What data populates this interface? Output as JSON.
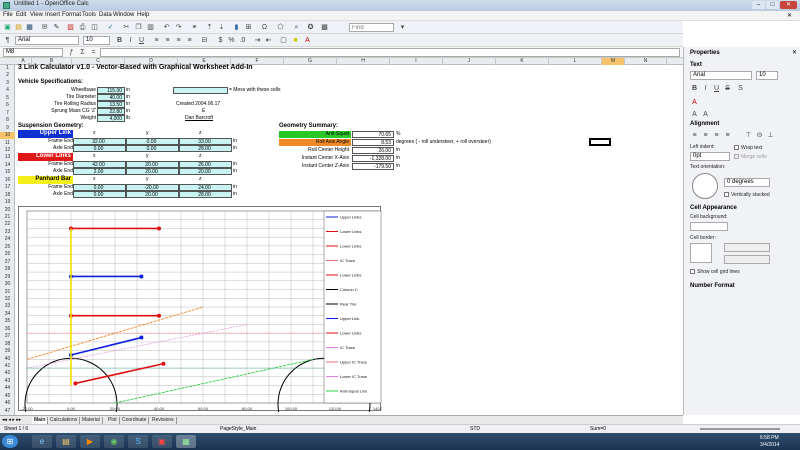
{
  "window": {
    "title": "Untitled 1 - OpenOffice Calc"
  },
  "menu": [
    "File",
    "Edit",
    "View",
    "Insert",
    "Format",
    "Tools",
    "Data",
    "Window",
    "Help"
  ],
  "toolbar": {
    "font_name": "Arial",
    "font_size": "10",
    "find_placeholder": "Find"
  },
  "formula": {
    "cell_ref": "M8"
  },
  "columns": [
    "A",
    "B",
    "C",
    "D",
    "E",
    "F",
    "G",
    "H",
    "I",
    "J",
    "K",
    "L",
    "M",
    "N"
  ],
  "rows": [
    "1",
    "2",
    "3",
    "4",
    "5",
    "6",
    "7",
    "8",
    "9",
    "10",
    "11",
    "12",
    "13",
    "14",
    "15",
    "16",
    "17",
    "18",
    "19",
    "20",
    "21",
    "22",
    "23",
    "24",
    "25",
    "26",
    "27",
    "28",
    "29",
    "30",
    "31",
    "32",
    "33",
    "34",
    "35",
    "36",
    "37",
    "38",
    "39",
    "40",
    "41",
    "42",
    "43",
    "44",
    "45",
    "46",
    "47"
  ],
  "sheet": {
    "title": "3 Link Calculator v1.0  -  Vector-Based with Graphical Worksheet Add-In",
    "vehicle_specs": "Vehicle Specifications:",
    "labels": {
      "wheelbase": "Wheelbase",
      "tire_diameter": "Tire Diameter",
      "tire_rolling_radius": "Tire Rolling Radius",
      "sprung_mass_cg": "Sprung Mass CG 'Z'",
      "weight": "Weight"
    },
    "values": {
      "wheelbase": "115.00",
      "tire_diameter": "40.00",
      "tire_rolling_radius": "13.50",
      "sprung_mass_cg": "22.80",
      "weight": "4,000"
    },
    "units": {
      "in": "in",
      "lb": "lb"
    },
    "legend_note": "= Mess with these cells",
    "created": "Created 2004.06.17",
    "author_e": "E",
    "author": "Dan Barcroft",
    "suspension": "Suspension Geometry:",
    "upper_link": "Upper Link",
    "lower_links": "Lower Links",
    "panhard": "Panhard Bar",
    "x": "x",
    "y": "y",
    "z": "z",
    "frame_end": "Frame End",
    "axle_end": "Axle End",
    "upper": {
      "frame": [
        "32.00",
        "0.00",
        "33.00"
      ],
      "axle": [
        "0.00",
        "0.00",
        "28.00"
      ]
    },
    "lower": {
      "frame": [
        "42.00",
        "20.00",
        "26.00"
      ],
      "axle": [
        "2.00",
        "20.00",
        "20.00"
      ]
    },
    "pan": {
      "frame": [
        "0.00",
        "-20.00",
        "24.00"
      ],
      "axle": [
        "0.00",
        "20.00",
        "28.00"
      ]
    },
    "geom_summary": "Geometry Summary:",
    "g_labels": [
      "Anti-Squat",
      "Roll Axis Angle",
      "Roll Center Height",
      "Instant Center X-Axis",
      "Instant Center Z-Axis"
    ],
    "g_values": [
      "70.65",
      "8.53",
      "26.00",
      "-1,328.00",
      "-179.50"
    ],
    "g_units": [
      "%",
      "degrees ( - roll understeer, + roll oversteer)",
      "in",
      "in",
      "in"
    ]
  },
  "chart_data": {
    "type": "line",
    "x_ticks": [
      "-20.00",
      "0.00",
      "20.00",
      "40.00",
      "60.00",
      "80.00",
      "100.00",
      "120.00",
      "140.00"
    ],
    "xlim": [
      -20,
      140
    ],
    "ylim": [
      -2,
      42
    ],
    "legend": [
      "Upper Links",
      "Lower Links",
      "Lower Links",
      "IC Trace",
      "Lower Links",
      "Column C",
      "Rear Tire",
      "Upper Link",
      "Lower Links",
      "IC Trace",
      "Upper IC Trace",
      "Lower IC Trace",
      "Anti-Squat Line"
    ],
    "series": [
      {
        "color": "#e01010",
        "x": [
          0,
          40
        ],
        "y": [
          38,
          38
        ]
      },
      {
        "color": "#1020e0",
        "x": [
          0,
          32
        ],
        "y": [
          27,
          27
        ]
      },
      {
        "color": "#e01010",
        "x": [
          0,
          40
        ],
        "y": [
          18,
          18
        ]
      },
      {
        "color": "#1020e0",
        "x": [
          0,
          32
        ],
        "y": [
          9,
          13
        ]
      },
      {
        "color": "#e01010",
        "x": [
          2,
          42
        ],
        "y": [
          2.5,
          7
        ]
      },
      {
        "color": "#f0e000",
        "x": [
          0,
          0
        ],
        "y": [
          38,
          2
        ]
      }
    ]
  },
  "sidebar": {
    "title": "Properties",
    "text": "Text",
    "font": "Arial",
    "size": "10",
    "alignment": "Alignment",
    "left_indent": "Left indent:",
    "indent_val": "0pt",
    "wrap": "Wrap text",
    "merge": "Merge cells",
    "orientation": "Text orientation:",
    "deg": "0 degrees",
    "vstack": "Vertically stacked",
    "cell_appearance": "Cell Appearance",
    "cell_bg": "Cell background:",
    "cell_border": "Cell border:",
    "grid": "Show cell grid lines",
    "number_format": "Number Format"
  },
  "tabs": [
    "Main",
    "Calculations",
    "Material",
    "Plot",
    "Coordinate",
    "Revisions"
  ],
  "status": {
    "sheet": "Sheet 1 / 6",
    "style": "PageStyle_Main",
    "std": "STD",
    "sum": "Sum=0"
  },
  "clock": {
    "time": "6:58 PM",
    "date": "3/4/2014"
  }
}
